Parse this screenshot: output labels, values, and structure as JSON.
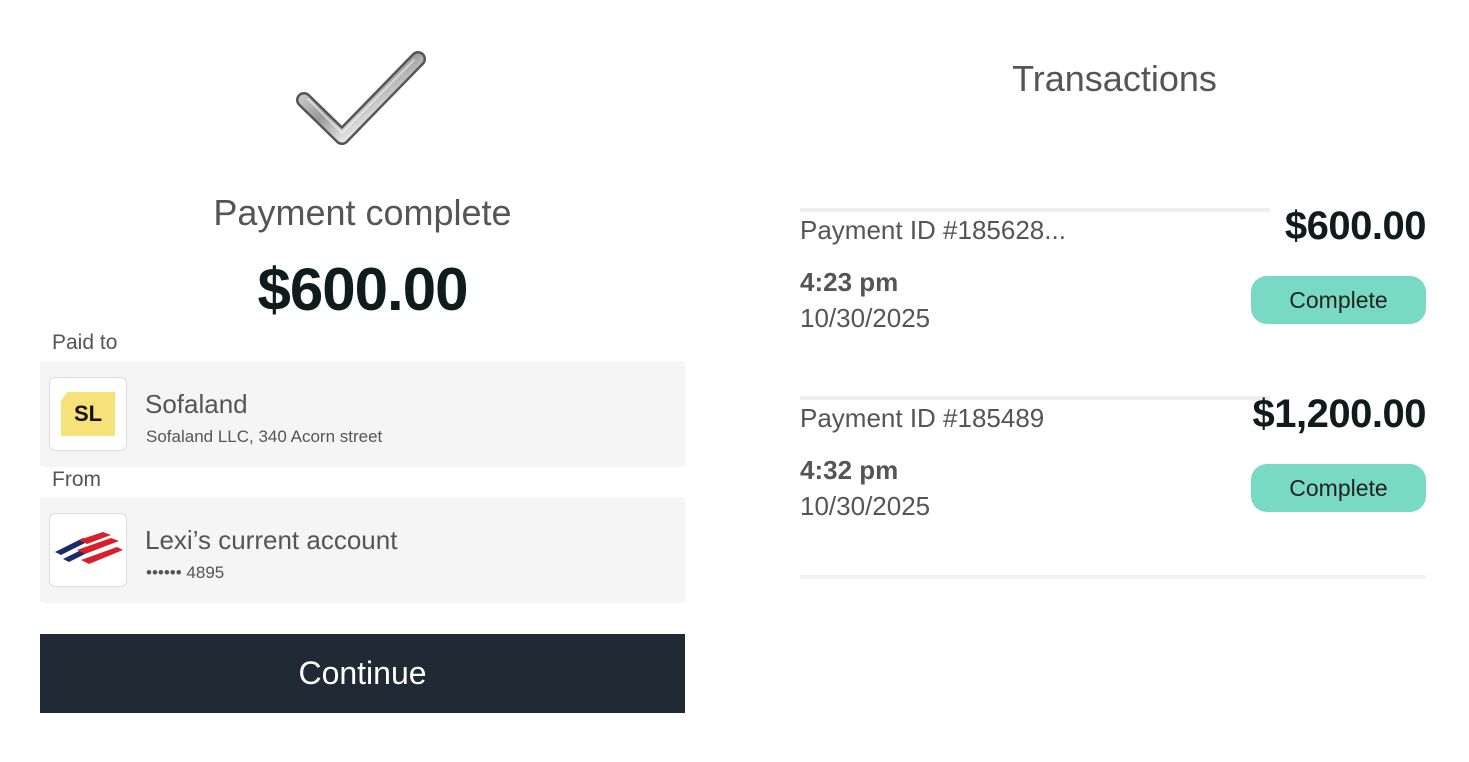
{
  "confirmation": {
    "title": "Payment complete",
    "amount": "$600.00"
  },
  "paid_to": {
    "label": "Paid to",
    "logo_text": "SL",
    "name": "Sofaland",
    "detail": "Sofaland LLC, 340 Acorn street"
  },
  "from": {
    "label": "From",
    "logo_icon": "bank-flag-icon",
    "name": "Lexi’s current account",
    "detail": "•••••• 4895"
  },
  "continue_label": "Continue",
  "transactions": {
    "title": "Transactions",
    "items": [
      {
        "id": "Payment ID #185628...",
        "amount": "$600.00",
        "time": "4:23 pm",
        "date": "10/30/2025",
        "status": "Complete"
      },
      {
        "id": "Payment ID #185489",
        "amount": "$1,200.00",
        "time": "4:32 pm",
        "date": "10/30/2025",
        "status": "Complete"
      }
    ]
  },
  "colors": {
    "button_bg": "#202a35",
    "status_bg": "#78dac5",
    "card_bg": "#f5f5f5",
    "logo_yellow": "#f7e27a"
  }
}
